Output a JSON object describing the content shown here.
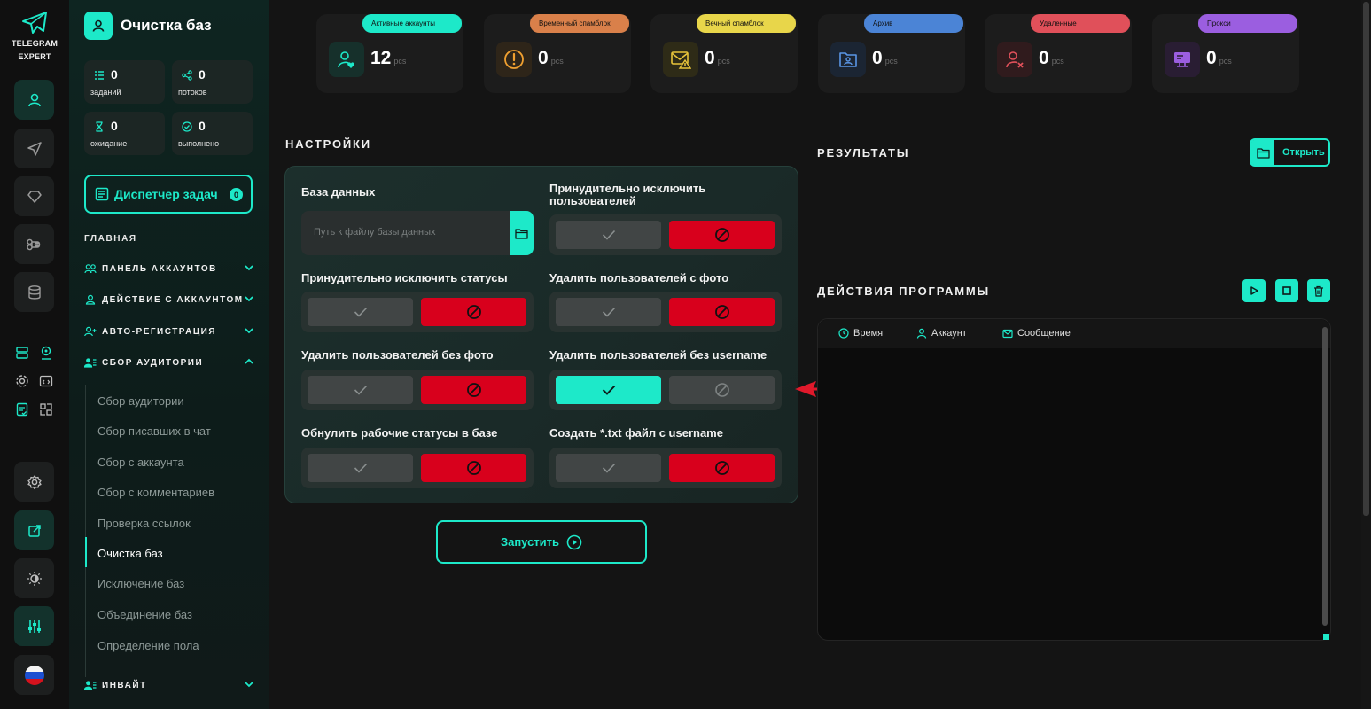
{
  "app": {
    "logo_line1": "TELEGRAM",
    "logo_line2": "EXPERT"
  },
  "sidebar": {
    "title": "Очистка баз",
    "stats": [
      {
        "value": "0",
        "label": "заданий"
      },
      {
        "value": "0",
        "label": "потоков"
      },
      {
        "value": "0",
        "label": "ожидание"
      },
      {
        "value": "0",
        "label": "выполнено"
      }
    ],
    "dispatcher": {
      "label": "Диспетчер задач",
      "count": "0"
    },
    "section": "ГЛАВНАЯ",
    "menu": [
      {
        "label": "ПАНЕЛЬ АККАУНТОВ"
      },
      {
        "label": "ДЕЙСТВИЕ С АККАУНТОМ"
      },
      {
        "label": "АВТО-РЕГИСТРАЦИЯ"
      },
      {
        "label": "СБОР АУДИТОРИИ"
      },
      {
        "label": "ИНВАЙТ"
      }
    ],
    "submenu": [
      "Сбор аудитории",
      "Сбор писавших в чат",
      "Сбор с аккаунта",
      "Сбор с комментариев",
      "Проверка ссылок",
      "Очистка баз",
      "Исключение баз",
      "Объединение баз",
      "Определение пола"
    ]
  },
  "cards": [
    {
      "tag": "Активные аккаунты",
      "value": "12",
      "unit": "pcs",
      "color": "#1de9c9",
      "icon": "user-heart-icon"
    },
    {
      "tag": "Временный спамблок",
      "value": "0",
      "unit": "pcs",
      "color": "#d9804a",
      "icon": "warning-icon"
    },
    {
      "tag": "Вечный спамблок",
      "value": "0",
      "unit": "pcs",
      "color": "#e8d64a",
      "icon": "mail-warning-icon"
    },
    {
      "tag": "Архив",
      "value": "0",
      "unit": "pcs",
      "color": "#4b84d6",
      "icon": "archive-folder-icon"
    },
    {
      "tag": "Удаленные",
      "value": "0",
      "unit": "pcs",
      "color": "#e0505a",
      "icon": "user-x-icon"
    },
    {
      "tag": "Прокси",
      "value": "0",
      "unit": "pcs",
      "color": "#9b5ee0",
      "icon": "proxy-icon"
    }
  ],
  "settings": {
    "title": "НАСТРОЙКИ",
    "database": {
      "label": "База данных",
      "placeholder": "Путь к файлу базы данных"
    },
    "options": [
      {
        "label": "Принудительно исключить пользователей",
        "enabled": false
      },
      {
        "label": "Принудительно исключить статусы",
        "enabled": false
      },
      {
        "label": "Удалить пользователей с фото",
        "enabled": false
      },
      {
        "label": "Удалить пользователей без фото",
        "enabled": false
      },
      {
        "label": "Удалить пользователей без username",
        "enabled": true
      },
      {
        "label": "Обнулить рабочие статусы в базе",
        "enabled": false
      },
      {
        "label": "Создать *.txt файл с username",
        "enabled": false
      }
    ],
    "run_label": "Запустить"
  },
  "results": {
    "title": "РЕЗУЛЬТАТЫ",
    "open_label": "Открыть"
  },
  "log": {
    "title": "ДЕЙСТВИЯ ПРОГРАММЫ",
    "columns": [
      "Время",
      "Аккаунт",
      "Сообщение"
    ]
  },
  "colors": {
    "accent": "#1de9c9",
    "danger": "#d8001c",
    "annotation": "#e0192b"
  }
}
